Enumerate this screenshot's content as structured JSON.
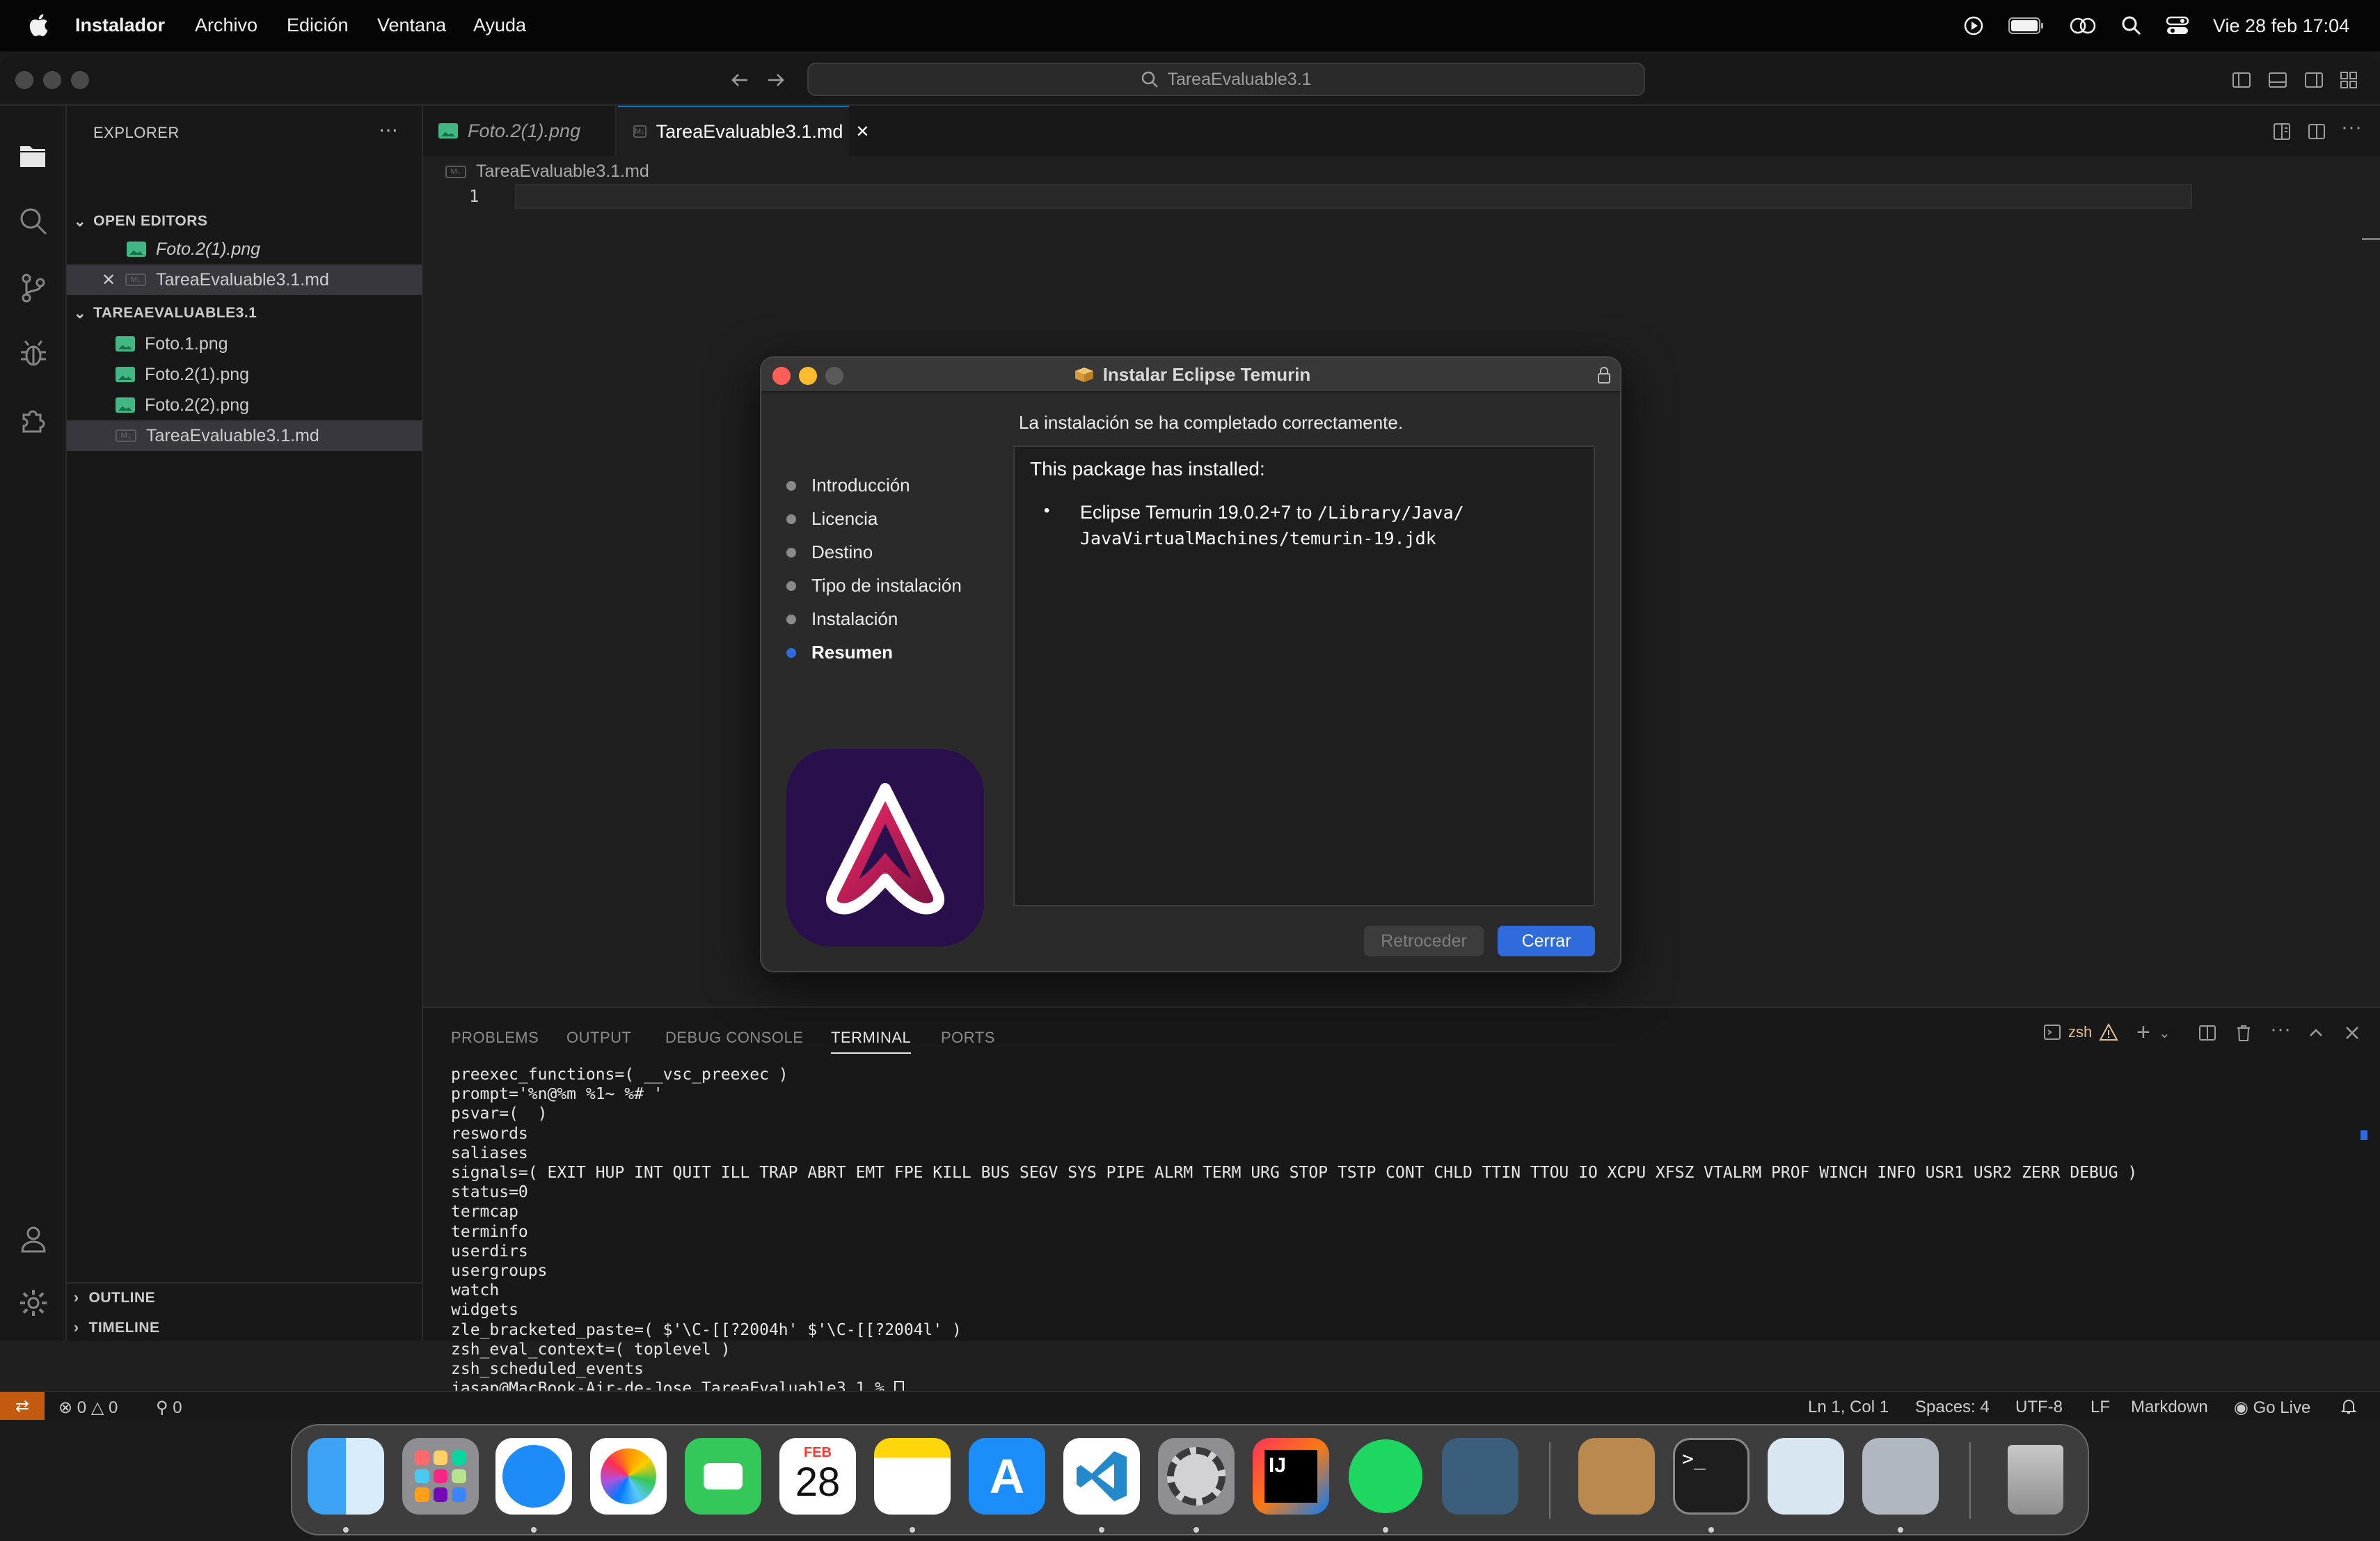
{
  "menubar": {
    "app_name": "Instalador",
    "items": [
      "Archivo",
      "Edición",
      "Ventana",
      "Ayuda"
    ],
    "datetime": "Vie 28 feb 17:04"
  },
  "window": {
    "command_center": "TareaEvaluable3.1"
  },
  "sidebar": {
    "title": "EXPLORER",
    "more": "···",
    "open_editors_header": "OPEN EDITORS",
    "open_editors": [
      "Foto.2(1).png",
      "TareaEvaluable3.1.md"
    ],
    "folder_header": "TAREAEVALUABLE3.1",
    "files": [
      "Foto.1.png",
      "Foto.2(1).png",
      "Foto.2(2).png",
      "TareaEvaluable3.1.md"
    ],
    "outline_header": "OUTLINE",
    "timeline_header": "TIMELINE"
  },
  "editor": {
    "tabs": [
      "Foto.2(1).png",
      "TareaEvaluable3.1.md"
    ],
    "breadcrumb": "TareaEvaluable3.1.md",
    "line_number": "1"
  },
  "installer": {
    "title": "Instalar Eclipse Temurin",
    "heading": "La instalación se ha completado correctamente.",
    "steps": [
      "Introducción",
      "Licencia",
      "Destino",
      "Tipo de instalación",
      "Instalación",
      "Resumen"
    ],
    "active_step": "Resumen",
    "content_title": "This package has installed:",
    "bullet_prefix": "Eclipse Temurin 19.0.2+7 to ",
    "bullet_path_1": "/Library/Java/",
    "bullet_path_2": "JavaVirtualMachines/temurin-19.jdk",
    "back_button": "Retroceder",
    "close_button": "Cerrar",
    "accent": "#2f6bdd"
  },
  "panel": {
    "tabs": [
      "PROBLEMS",
      "OUTPUT",
      "DEBUG CONSOLE",
      "TERMINAL",
      "PORTS"
    ],
    "active_tab": "TERMINAL",
    "shell": "zsh",
    "terminal_lines": [
      "preexec_functions=( __vsc_preexec )",
      "prompt='%n@%m %1~ %# '",
      "psvar=(  )",
      "reswords",
      "saliases",
      "signals=( EXIT HUP INT QUIT ILL TRAP ABRT EMT FPE KILL BUS SEGV SYS PIPE ALRM TERM URG STOP TSTP CONT CHLD TTIN TTOU IO XCPU XFSZ VTALRM PROF WINCH INFO USR1 USR2 ZERR DEBUG )",
      "status=0",
      "termcap",
      "terminfo",
      "userdirs",
      "usergroups",
      "watch",
      "widgets",
      "zle_bracketed_paste=( $'\\C-[[?2004h' $'\\C-[[?2004l' )",
      "zsh_eval_context=( toplevel )",
      "zsh_scheduled_events"
    ],
    "prompt": "jasap@MacBook-Air-de-Jose TareaEvaluable3.1 % "
  },
  "statusbar": {
    "errors": "0",
    "warnings": "0",
    "ports": "0",
    "position": "Ln 1, Col 1",
    "spaces": "Spaces: 4",
    "encoding": "UTF-8",
    "eol": "LF",
    "language": "Markdown",
    "golive": "Go Live"
  },
  "dock": {
    "calendar_month": "FEB",
    "calendar_day": "28",
    "apps": [
      "Finder",
      "Launchpad",
      "Safari",
      "Photos",
      "FaceTime",
      "Calendar",
      "Notes",
      "App Store",
      "Visual Studio Code",
      "System Settings",
      "IntelliJ IDEA",
      "Spotify",
      "MySQL Workbench",
      "Contacts",
      "Terminal",
      "Preview",
      "Downloads",
      "Trash"
    ]
  }
}
